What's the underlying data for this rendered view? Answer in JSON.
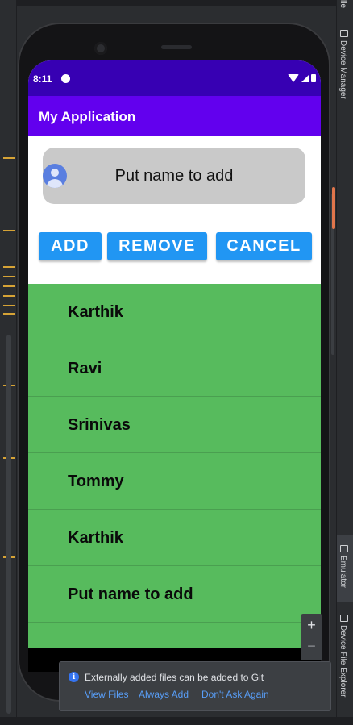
{
  "ide": {
    "tool_windows": {
      "top_partial": "lle",
      "device_manager": "Device Manager",
      "emulator": "Emulator",
      "device_file_explorer": "Device File Explorer"
    },
    "zoom": {
      "plus": "+",
      "minus": "−"
    }
  },
  "status_bar": {
    "time": "8:11"
  },
  "app": {
    "title": "My Application",
    "input_placeholder": "Put name to add",
    "buttons": {
      "add": "ADD",
      "remove": "REMOVE",
      "cancel": "CANCEL"
    },
    "list_items": [
      "Karthik",
      "Ravi",
      "Srinivas",
      "Tommy",
      "Karthik",
      "Put name to add"
    ]
  },
  "notification": {
    "message": "Externally added files can be added to Git",
    "links": [
      "View Files",
      "Always Add",
      "Don't Ask Again"
    ]
  },
  "colors": {
    "status_bar": "#3700b3",
    "app_bar": "#6200ee",
    "button": "#2196f3",
    "list_bg": "#57bb5d",
    "input_bg": "#c9c9c9"
  }
}
